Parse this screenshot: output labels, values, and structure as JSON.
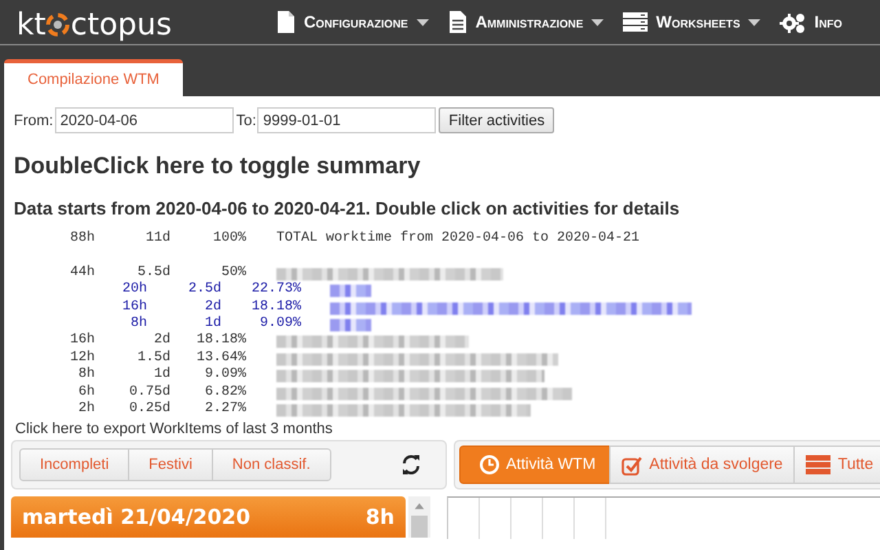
{
  "navbar": {
    "logo_left": "kt",
    "logo_right": "ctopus",
    "menu": [
      {
        "label": "Configurazione",
        "kind": "file",
        "dropdown": true
      },
      {
        "label": "Amministrazione",
        "kind": "document",
        "dropdown": true
      },
      {
        "label": "Worksheets",
        "kind": "list",
        "dropdown": true
      },
      {
        "label": "Info",
        "kind": "gears",
        "dropdown": false
      }
    ]
  },
  "tabs": [
    {
      "label": "Compilazione WTM",
      "selected": true
    }
  ],
  "filter": {
    "from_label": "From:",
    "from_value": "2020-04-06",
    "to_label": "To:",
    "to_value": "9999-01-01",
    "button": "Filter activities"
  },
  "summary": {
    "heading": "DoubleClick here to toggle summary",
    "subheading": "Data starts from 2020-04-06 to 2020-04-21. Double click on activities for details",
    "total": {
      "hours": "88h",
      "days": "11d",
      "percent": "100%",
      "label": "TOTAL worktime from 2020-04-06 to 2020-04-21"
    },
    "rows": [
      {
        "hours": "44h",
        "days": "5.5d",
        "percent": "50%",
        "children": [
          {
            "hours": "20h",
            "days": "2.5d",
            "percent": "22.73%"
          },
          {
            "hours": "16h",
            "days": "2d",
            "percent": "18.18%"
          },
          {
            "hours": "8h",
            "days": "1d",
            "percent": "9.09%"
          }
        ]
      },
      {
        "hours": "16h",
        "days": "2d",
        "percent": "18.18%"
      },
      {
        "hours": "12h",
        "days": "1.5d",
        "percent": "13.64%"
      },
      {
        "hours": "8h",
        "days": "1d",
        "percent": "9.09%"
      },
      {
        "hours": "6h",
        "days": "0.75d",
        "percent": "6.82%"
      },
      {
        "hours": "2h",
        "days": "0.25d",
        "percent": "2.27%"
      }
    ]
  },
  "export_link": "Click here to export WorkItems of last 3 months",
  "filter_buttons": [
    "Incompleti",
    "Festivi",
    "Non classif."
  ],
  "view_tabs": [
    {
      "label": "Attività WTM",
      "kind": "clock",
      "selected": true
    },
    {
      "label": "Attività da svolgere",
      "kind": "checkbox",
      "selected": false
    },
    {
      "label": "Tutte",
      "kind": "list",
      "selected": false
    }
  ],
  "day": {
    "date": "martedì 21/04/2020",
    "hours": "8h"
  }
}
